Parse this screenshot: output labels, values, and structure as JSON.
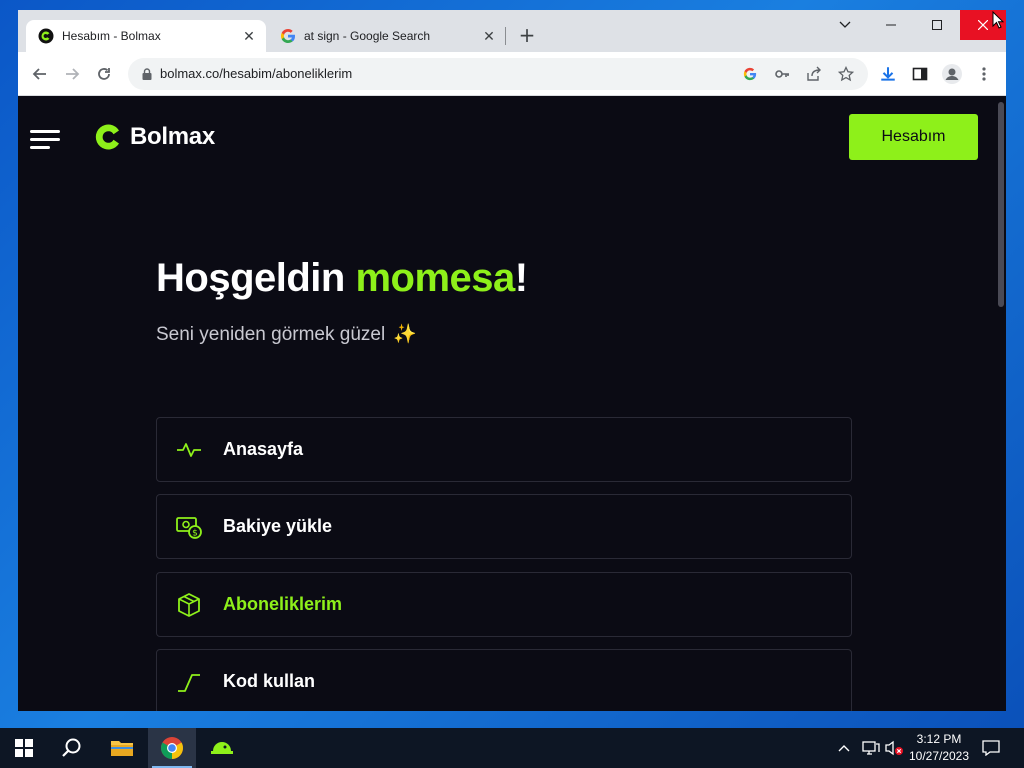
{
  "browser": {
    "tabs": [
      {
        "title": "Hesabım - Bolmax",
        "active": true,
        "icon": "bolmax-favicon"
      },
      {
        "title": "at sign - Google Search",
        "active": false,
        "icon": "google-favicon"
      }
    ],
    "url": "bolmax.co/hesabim/aboneliklerim",
    "close_glyph": "✕",
    "new_tab_glyph": "+"
  },
  "site": {
    "brand": "Bolmax",
    "account_button": "Hesabım",
    "welcome_prefix": "Hoşgeldin ",
    "username": "momesa",
    "welcome_suffix": "!",
    "subtitle": "Seni yeniden görmek güzel",
    "subtitle_emoji": "✨",
    "accent_color": "#8ef01a",
    "menu": [
      {
        "label": "Anasayfa",
        "icon": "activity-icon",
        "selected": false
      },
      {
        "label": "Bakiye yükle",
        "icon": "money-icon",
        "selected": false
      },
      {
        "label": "Aboneliklerim",
        "icon": "box-icon",
        "selected": true
      },
      {
        "label": "Kod kullan",
        "icon": "step-icon",
        "selected": false
      }
    ]
  },
  "taskbar": {
    "time": "3:12 PM",
    "date": "10/27/2023"
  }
}
